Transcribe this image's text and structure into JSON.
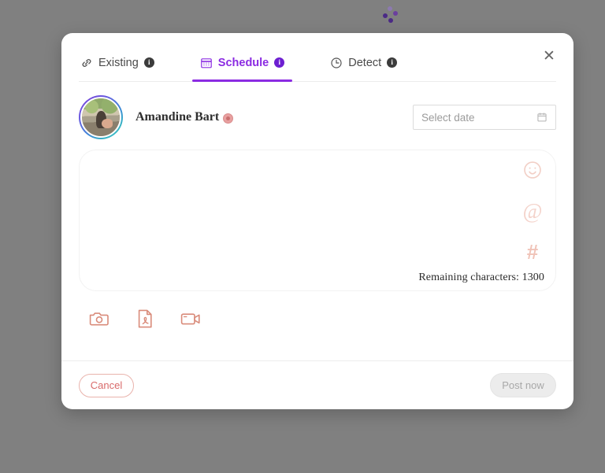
{
  "background_color": "#808080",
  "spinner": {
    "name": "loading-spinner",
    "color": "#5b2d90",
    "dot_count": 4
  },
  "modal": {
    "close_label": "✕",
    "tabs": [
      {
        "label": "Existing",
        "icon": "link-icon",
        "active": false,
        "badge": "i"
      },
      {
        "label": "Schedule",
        "icon": "calendar-icon",
        "active": true,
        "badge": "i"
      },
      {
        "label": "Detect",
        "icon": "clock-icon",
        "active": false,
        "badge": "i"
      }
    ],
    "active_tab": "Schedule",
    "accent_color": "#8b2be2",
    "account": {
      "name": "Amandine Bart",
      "emoji": "🎯",
      "avatar_name": "avatar"
    },
    "date_picker": {
      "placeholder": "Select date",
      "value": "",
      "icon": "calendar-icon"
    },
    "composer": {
      "placeholder": "",
      "value": "",
      "char_count_label": "Remaining characters: 1300",
      "remaining_characters": 1300,
      "tools": [
        {
          "name": "emoji-icon",
          "glyph": "smiley"
        },
        {
          "name": "mention-icon",
          "glyph": "@"
        },
        {
          "name": "hashtag-icon",
          "glyph": "#"
        }
      ],
      "tool_color": "#f0c8bf"
    },
    "attachments": [
      {
        "name": "photo-attach-button",
        "icon": "camera-icon"
      },
      {
        "name": "pdf-attach-button",
        "icon": "pdf-file-icon"
      },
      {
        "name": "video-attach-button",
        "icon": "video-camera-icon"
      }
    ],
    "attachment_color": "#d98b7a",
    "footer": {
      "cancel_label": "Cancel",
      "cancel_color": "#d96b6b",
      "post_label": "Post now",
      "post_enabled": false
    }
  }
}
